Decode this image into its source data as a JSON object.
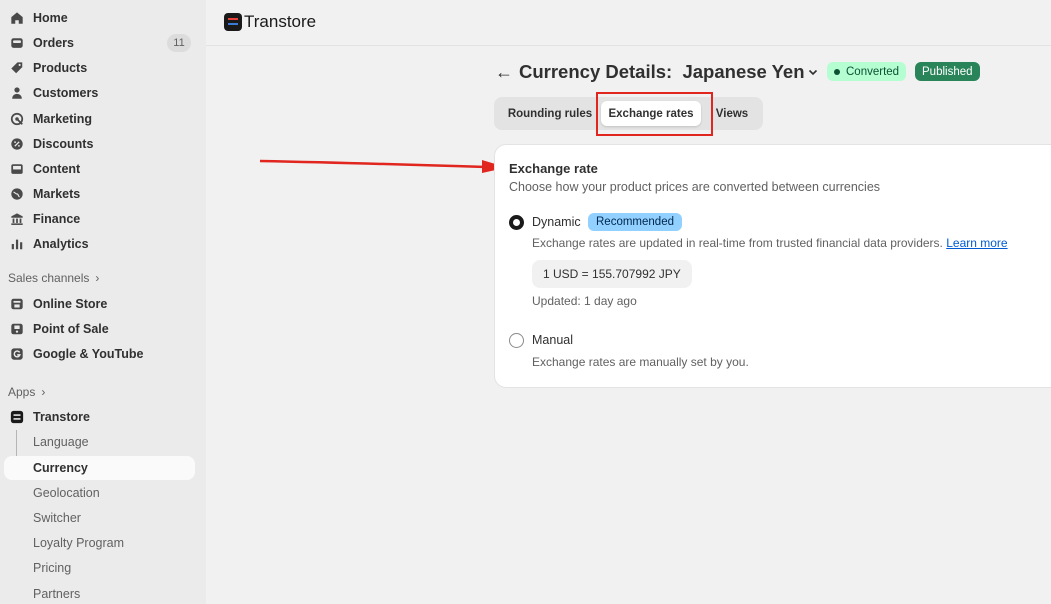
{
  "sidebar": {
    "items": [
      {
        "label": "Home",
        "icon": "home-icon"
      },
      {
        "label": "Orders",
        "icon": "inbox-icon",
        "count": "11"
      },
      {
        "label": "Products",
        "icon": "tag-icon"
      },
      {
        "label": "Customers",
        "icon": "person-icon"
      },
      {
        "label": "Marketing",
        "icon": "target-icon"
      },
      {
        "label": "Discounts",
        "icon": "discount-icon"
      },
      {
        "label": "Content",
        "icon": "image-icon"
      },
      {
        "label": "Markets",
        "icon": "globe-icon"
      },
      {
        "label": "Finance",
        "icon": "bank-icon"
      },
      {
        "label": "Analytics",
        "icon": "bar-chart-icon"
      }
    ],
    "sales_channels_label": "Sales channels",
    "channels": [
      {
        "label": "Online Store",
        "icon": "store-icon"
      },
      {
        "label": "Point of Sale",
        "icon": "pos-icon"
      },
      {
        "label": "Google & YouTube",
        "icon": "google-icon"
      }
    ],
    "apps_label": "Apps",
    "app": {
      "label": "Transtore",
      "icon": "transtore-icon"
    },
    "app_subitems": [
      "Language",
      "Currency",
      "Geolocation",
      "Switcher",
      "Loyalty Program",
      "Pricing",
      "Partners"
    ],
    "active_subitem": "Currency"
  },
  "header": {
    "app_name": "Transtore"
  },
  "page": {
    "title": "Currency Details:  Japanese Yen",
    "status_converted": "Converted",
    "status_published": "Published",
    "colors": {
      "converted_bg": "#b4fed2",
      "published_bg": "#29845a",
      "highlight": "#e0261f"
    }
  },
  "tabs": [
    {
      "label": "Rounding rules"
    },
    {
      "label": "Exchange rates",
      "selected": true
    },
    {
      "label": "Views"
    }
  ],
  "card": {
    "title": "Exchange rate",
    "subtitle": "Choose how your product prices are converted between currencies",
    "dynamic": {
      "label": "Dynamic",
      "badge": "Recommended",
      "description": "Exchange rates are updated in real-time from trusted financial data providers.",
      "learn_more": "Learn more",
      "rate": "1 USD = 155.707992 JPY",
      "updated": "Updated: 1 day ago",
      "checked": true
    },
    "manual": {
      "label": "Manual",
      "description": "Exchange rates are manually set by you.",
      "checked": false
    }
  }
}
